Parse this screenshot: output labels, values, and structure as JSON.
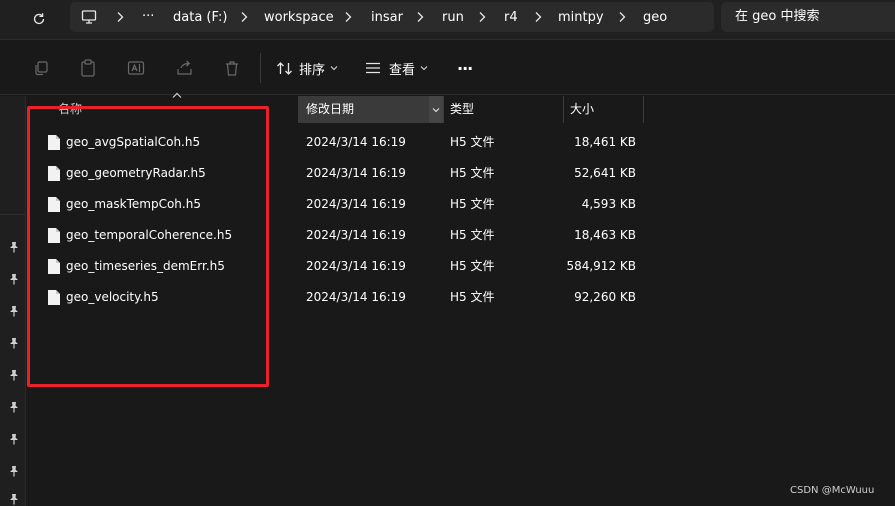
{
  "address_bar": {
    "breadcrumbs": [
      "data (F:)",
      "workspace",
      "insar",
      "run",
      "r4",
      "mintpy",
      "geo"
    ],
    "more": "···",
    "search_placeholder": "在 geo 中搜索"
  },
  "commandbar": {
    "sort_label": "排序",
    "view_label": "查看",
    "more": "···"
  },
  "columns": {
    "name": "名称",
    "date": "修改日期",
    "type": "类型",
    "size": "大小"
  },
  "files": [
    {
      "name": "geo_avgSpatialCoh.h5",
      "date": "2024/3/14 16:19",
      "type": "H5 文件",
      "size": "18,461 KB"
    },
    {
      "name": "geo_geometryRadar.h5",
      "date": "2024/3/14 16:19",
      "type": "H5 文件",
      "size": "52,641 KB"
    },
    {
      "name": "geo_maskTempCoh.h5",
      "date": "2024/3/14 16:19",
      "type": "H5 文件",
      "size": "4,593 KB"
    },
    {
      "name": "geo_temporalCoherence.h5",
      "date": "2024/3/14 16:19",
      "type": "H5 文件",
      "size": "18,463 KB"
    },
    {
      "name": "geo_timeseries_demErr.h5",
      "date": "2024/3/14 16:19",
      "type": "H5 文件",
      "size": "584,912 KB"
    },
    {
      "name": "geo_velocity.h5",
      "date": "2024/3/14 16:19",
      "type": "H5 文件",
      "size": "92,260 KB"
    }
  ],
  "watermark": "CSDN @McWuuu",
  "colors": {
    "background": "#191919",
    "toolbar": "#202020",
    "highlight": "#e8212b",
    "text": "#ffffff"
  }
}
